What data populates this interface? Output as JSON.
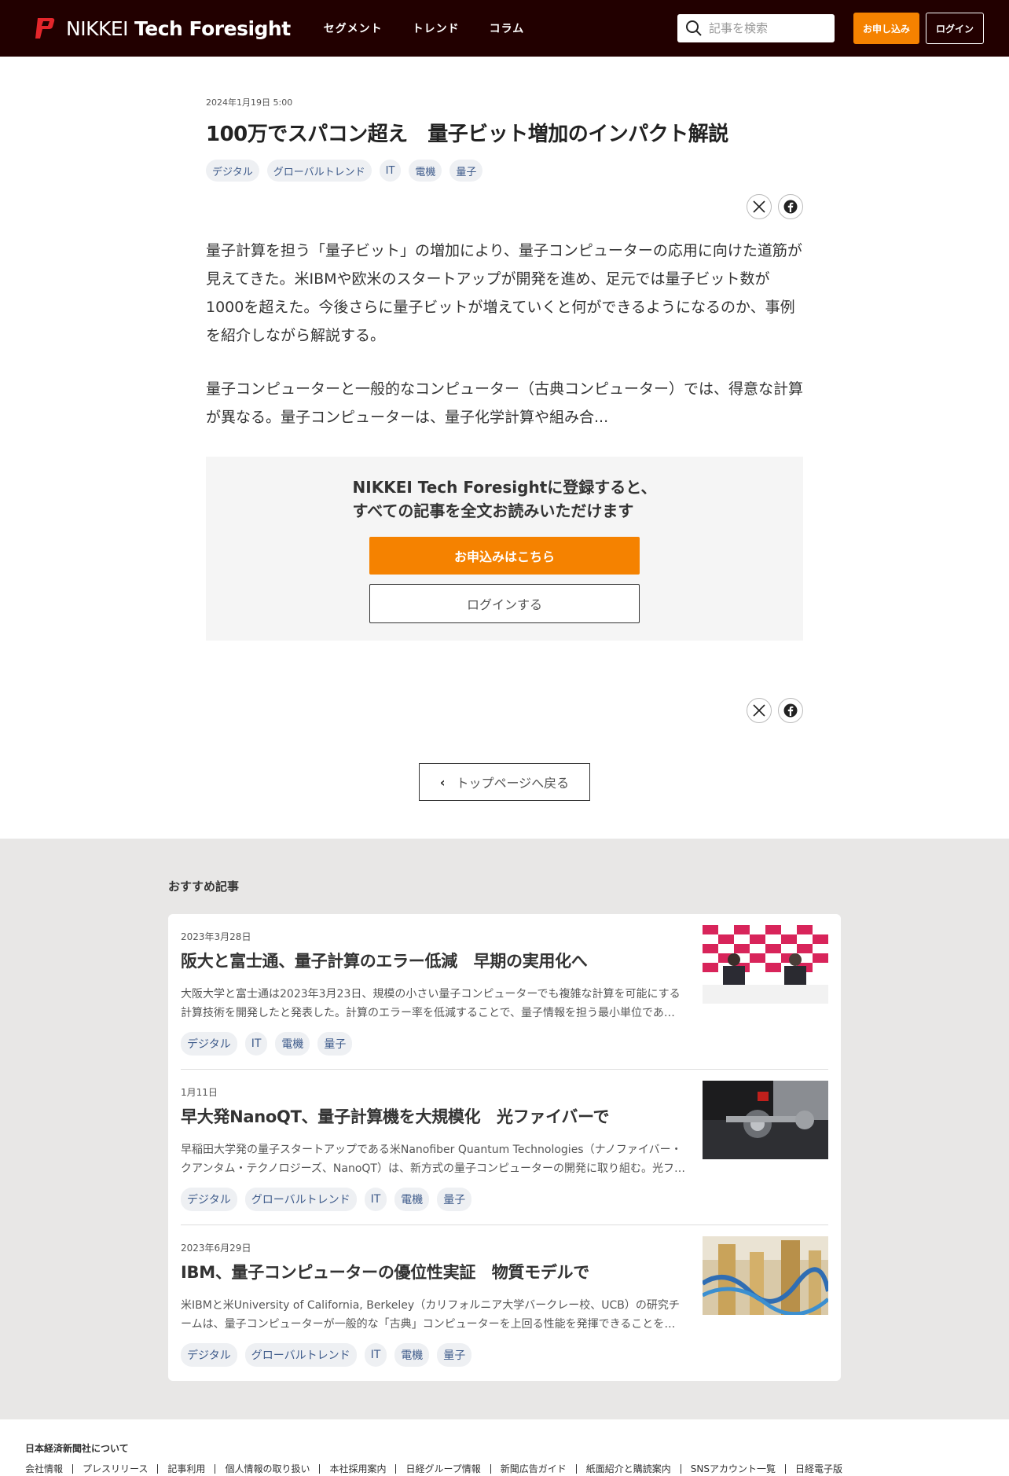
{
  "header": {
    "logo_light": "NIKKEI",
    "logo_bold": "Tech Foresight",
    "nav": [
      "セグメント",
      "トレンド",
      "コラム"
    ],
    "search_placeholder": "記事を検索",
    "subscribe_label": "お申し込み",
    "login_label": "ログイン"
  },
  "article": {
    "date": "2024年1月19日 5:00",
    "title": "100万でスパコン超え　量子ビット増加のインパクト解説",
    "tags": [
      "デジタル",
      "グローバルトレンド",
      "IT",
      "電機",
      "量子"
    ],
    "paragraphs": [
      "量子計算を担う「量子ビット」の増加により、量子コンピューターの応用に向けた道筋が見えてきた。米IBMや欧米のスタートアップが開発を進め、足元では量子ビット数が1000を超えた。今後さらに量子ビットが増えていくと何ができるようになるのか、事例を紹介しながら解説する。",
      "量子コンピューターと一般的なコンピューター（古典コンピューター）では、得意な計算が異なる。量子コンピューターは、量子化学計算や組み合..."
    ]
  },
  "paywall": {
    "line1": "NIKKEI Tech Foresightに登録すると、",
    "line2": "すべての記事を全文お読みいただけます",
    "subscribe_label": "お申込みはこちら",
    "login_label": "ログインする"
  },
  "back_label": "トップページへ戻る",
  "recommended": {
    "heading": "おすすめ記事",
    "items": [
      {
        "date": "2023年3月28日",
        "title": "阪大と富士通、量子計算のエラー低減　早期の実用化へ",
        "desc": "大阪大学と富士通は2023年3月23日、規模の小さい量子コンピューターでも複雑な計算を可能にする計算技術を開発したと発表した。計算のエラー率を低減することで、量子情報を担う最小単位である「量子ビット」…",
        "tags": [
          "デジタル",
          "IT",
          "電機",
          "量子"
        ]
      },
      {
        "date": "1月11日",
        "title": "早大発NanoQT、量子計算機を大規模化　光ファイバーで",
        "desc": "早稲田大学発の量子スタートアップである米Nanofiber Quantum Technologies（ナノファイバー・クアンタム・テクノロジーズ、NanoQT）は、新方式の量子コンピューターの開発に取り組む。光ファイバー…",
        "tags": [
          "デジタル",
          "グローバルトレンド",
          "IT",
          "電機",
          "量子"
        ]
      },
      {
        "date": "2023年6月29日",
        "title": "IBM、量子コンピューターの優位性実証　物質モデルで",
        "desc": "米IBMと米University of California, Berkeley（カリフォルニア大学バークレー校、UCB）の研究チームは、量子コンピューターが一般的な「古典」コンピューターを上回る性能を発揮できることを初めて…",
        "tags": [
          "デジタル",
          "グローバルトレンド",
          "IT",
          "電機",
          "量子"
        ]
      }
    ]
  },
  "footer": {
    "heading": "日本経済新聞社について",
    "links": [
      "会社情報",
      "プレスリリース",
      "記事利用",
      "個人情報の取り扱い",
      "本社採用案内",
      "日経グループ情報",
      "新聞広告ガイド",
      "紙面紹介と購読案内",
      "SNSアカウント一覧",
      "日経電子版"
    ]
  },
  "colors": {
    "header_bg": "#220000",
    "accent": "#f58200",
    "tag_text": "#3d5a8a"
  }
}
